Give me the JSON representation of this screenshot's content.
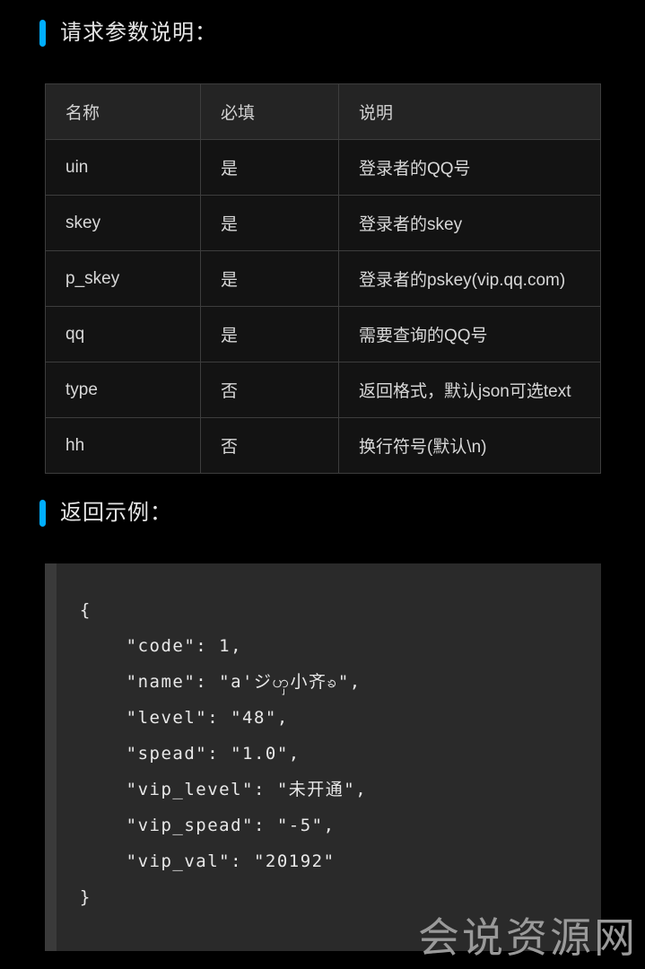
{
  "theme": {
    "background": "#000000",
    "accent": "#00AEFF",
    "table_header_bg": "#242424",
    "table_body_bg": "#131313",
    "table_border": "#3d3d3d",
    "code_bg": "#2a2a2a",
    "code_gutter_bg": "#3a3a3a",
    "text": "#e6e6e6"
  },
  "sections": {
    "params": {
      "heading": "请求参数说明："
    },
    "example": {
      "heading": "返回示例："
    }
  },
  "param_table": {
    "headers": [
      "名称",
      "必填",
      "说明"
    ],
    "rows": [
      {
        "name": "uin",
        "required": "是",
        "desc": "登录者的QQ号"
      },
      {
        "name": "skey",
        "required": "是",
        "desc": "登录者的skey"
      },
      {
        "name": "p_skey",
        "required": "是",
        "desc": "登录者的pskey(vip.qq.com)"
      },
      {
        "name": "qq",
        "required": "是",
        "desc": "需要查询的QQ号"
      },
      {
        "name": "type",
        "required": "否",
        "desc": "返回格式，默认json可选text"
      },
      {
        "name": "hh",
        "required": "否",
        "desc": "换行符号(默认\\n)"
      }
    ]
  },
  "code_example": {
    "language": "json",
    "lines": [
      "  {",
      "      \"code\": 1,",
      "      \"name\": \"a'ジၯ小齐ၶ\",",
      "      \"level\": \"48\",",
      "      \"spead\": \"1.0\",",
      "      \"vip_level\": \"未开通\",",
      "      \"vip_spead\": \"-5\",",
      "      \"vip_val\": \"20192\"",
      "  }"
    ],
    "fields": {
      "code": 1,
      "name": "a'ジၯ小齐ၶ",
      "level": "48",
      "spead": "1.0",
      "vip_level": "未开通",
      "vip_spead": "-5",
      "vip_val": "20192"
    }
  },
  "watermark": {
    "text": "会说资源网"
  }
}
